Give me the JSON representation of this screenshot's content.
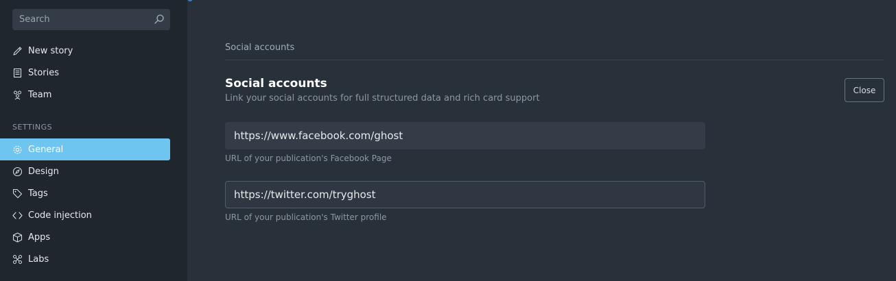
{
  "sidebar": {
    "search": {
      "placeholder": "Search",
      "icon": "search-icon"
    },
    "primary": [
      {
        "label": "New story",
        "icon": "pencil-icon"
      },
      {
        "label": "Stories",
        "icon": "document-icon"
      },
      {
        "label": "Team",
        "icon": "team-icon"
      }
    ],
    "section_label": "SETTINGS",
    "settings": [
      {
        "label": "General",
        "icon": "gear-icon",
        "active": true
      },
      {
        "label": "Design",
        "icon": "compass-icon"
      },
      {
        "label": "Tags",
        "icon": "tag-icon"
      },
      {
        "label": "Code injection",
        "icon": "code-icon"
      },
      {
        "label": "Apps",
        "icon": "box-icon"
      },
      {
        "label": "Labs",
        "icon": "labs-icon"
      }
    ]
  },
  "main": {
    "breadcrumb": "Social accounts",
    "title": "Social accounts",
    "subtitle": "Link your social accounts for full structured data and rich card support",
    "close_label": "Close",
    "facebook": {
      "value": "https://www.facebook.com/ghost",
      "help": "URL of your publication's Facebook Page"
    },
    "twitter": {
      "value": "https://twitter.com/tryghost",
      "help": "URL of your publication's Twitter profile"
    }
  },
  "colors": {
    "sidebar_bg": "#1f262d",
    "main_bg": "#28303a",
    "accent": "#6ec5ef"
  }
}
